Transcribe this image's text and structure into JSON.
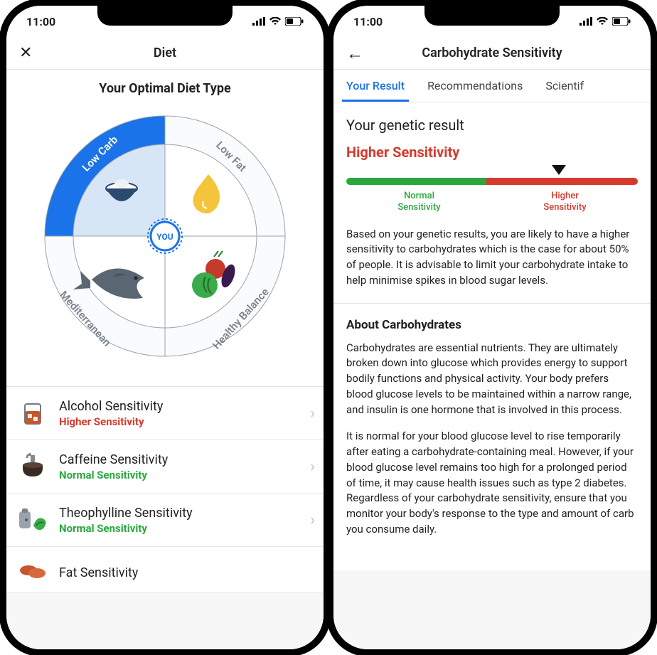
{
  "status": {
    "time": "11:00"
  },
  "diet": {
    "close_glyph": "✕",
    "title": "Diet",
    "hero_title": "Your Optimal Diet Type",
    "you_label": "YOU",
    "segments": {
      "low_carb": "Low Carb",
      "low_fat": "Low Fat",
      "healthy_balance": "Healthy Balance",
      "mediterranean": "Mediterranean"
    },
    "rows": [
      {
        "title": "Alcohol Sensitivity",
        "sub": "Higher Sensitivity",
        "level": "higher"
      },
      {
        "title": "Caffeine Sensitivity",
        "sub": "Normal Sensitivity",
        "level": "normal"
      },
      {
        "title": "Theophylline Sensitivity",
        "sub": "Normal Sensitivity",
        "level": "normal"
      },
      {
        "title": "Fat Sensitivity",
        "sub": "",
        "level": ""
      }
    ]
  },
  "detail": {
    "back_glyph": "←",
    "title": "Carbohydrate Sensitivity",
    "tabs": [
      "Your Result",
      "Recommendations",
      "Scientif"
    ],
    "section_title": "Your genetic result",
    "result": "Higher Sensitivity",
    "bar_labels": {
      "normal": "Normal\nSensitivity",
      "higher": "Higher\nSensitivity"
    },
    "summary": "Based on your genetic results, you are likely to have a higher sensitivity to carbohydrates which is the case for about 50% of people. It is advisable to limit your carbohydrate intake to help minimise spikes in blood sugar levels.",
    "about_title": "About Carbohydrates",
    "about_p1": "Carbohydrates are essential nutrients. They are ultimately broken down into glucose which provides energy to support bodily functions and physical activity. Your body prefers blood glucose levels to be maintained within a narrow range, and insulin is one hormone that is involved in this process.",
    "about_p2": "It is normal for your blood glucose level to rise temporarily after eating a carbohydrate-containing meal. However, if your blood glucose level remains too high for a prolonged period of time, it may cause health issues such as type 2 diabetes. Regardless of your carbohydrate sensitivity, ensure that you monitor your body's response to the type and amount of carb you consume daily."
  },
  "chart_data": {
    "type": "pie",
    "title": "Your Optimal Diet Type",
    "categories": [
      "Low Carb",
      "Low Fat",
      "Healthy Balance",
      "Mediterranean"
    ],
    "values": [
      25,
      25,
      25,
      25
    ],
    "selected": "Low Carb",
    "marker_label": "YOU"
  }
}
